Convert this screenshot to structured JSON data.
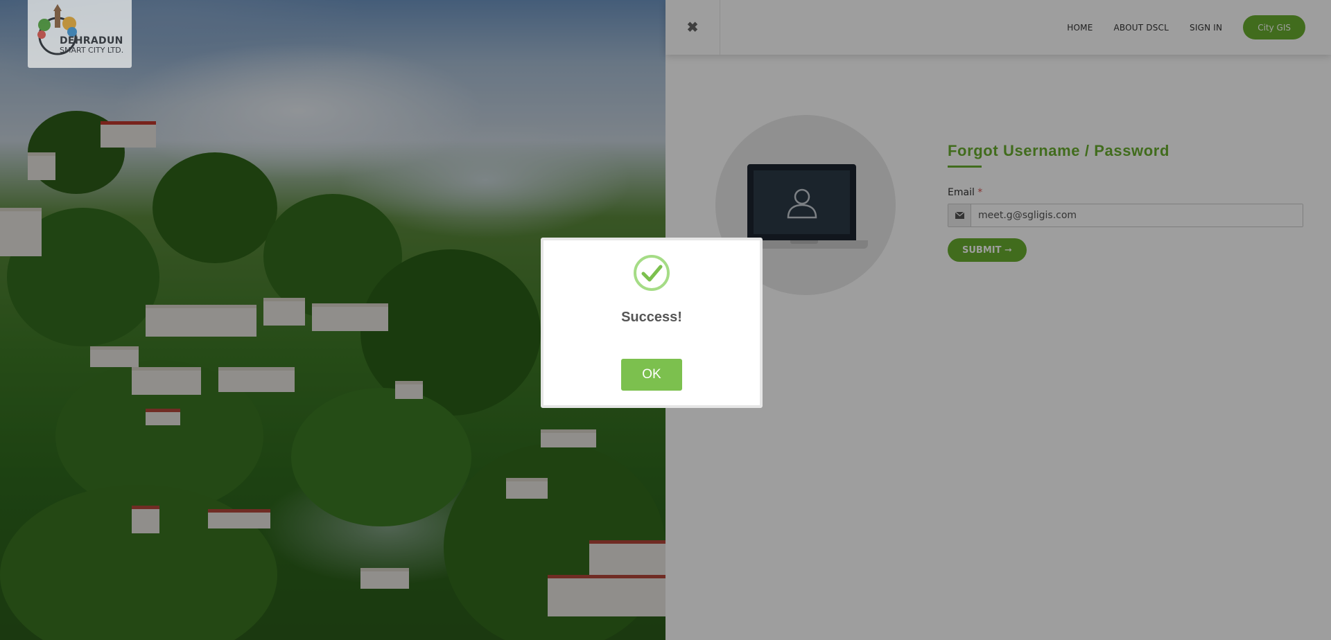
{
  "logo": {
    "title": "DEHRADUN",
    "subtitle": "SMART CITY LTD."
  },
  "nav": {
    "home": "HOME",
    "about": "ABOUT DSCL",
    "signin": "SIGN IN",
    "gis": "City GIS"
  },
  "icons": {
    "close": "close-icon",
    "email": "envelope-icon",
    "user": "user-icon",
    "check": "check-circle-icon",
    "arrow": "arrow-right-icon"
  },
  "form": {
    "title": "Forgot Username / Password",
    "email_label": "Email",
    "required_mark": "*",
    "email_value": "meet.g@sgligis.com",
    "submit_label": "SUBMIT ➞"
  },
  "modal": {
    "message": "Success!",
    "ok_label": "OK"
  },
  "colors": {
    "brand": "#6aaf2f",
    "ok_button": "#7cc04e",
    "overlay": "rgba(0,0,0,0.38)"
  }
}
